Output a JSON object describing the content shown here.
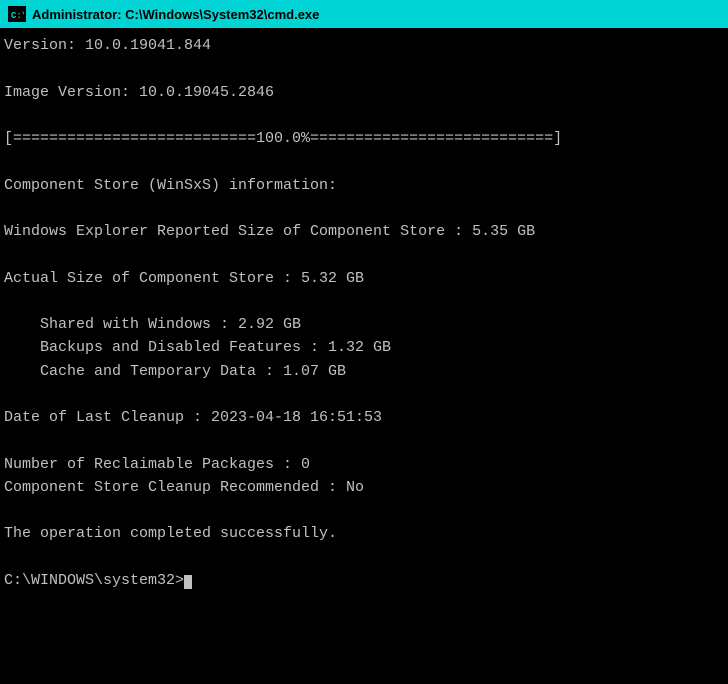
{
  "titleBar": {
    "label": "Administrator: C:\\Windows\\System32\\cmd.exe"
  },
  "console": {
    "lines": [
      {
        "id": "version",
        "text": "Version: 10.0.19041.844"
      },
      {
        "id": "empty1",
        "text": ""
      },
      {
        "id": "image-version",
        "text": "Image Version: 10.0.19045.2846"
      },
      {
        "id": "empty2",
        "text": ""
      },
      {
        "id": "progress",
        "text": "[===========================100.0%===========================]"
      },
      {
        "id": "empty3",
        "text": ""
      },
      {
        "id": "component-store-header",
        "text": "Component Store (WinSxS) information:"
      },
      {
        "id": "empty4",
        "text": ""
      },
      {
        "id": "explorer-size",
        "text": "Windows Explorer Reported Size of Component Store : 5.35 GB"
      },
      {
        "id": "empty5",
        "text": ""
      },
      {
        "id": "actual-size",
        "text": "Actual Size of Component Store : 5.32 GB"
      },
      {
        "id": "empty6",
        "text": ""
      },
      {
        "id": "shared",
        "text": "    Shared with Windows : 2.92 GB"
      },
      {
        "id": "backups",
        "text": "    Backups and Disabled Features : 1.32 GB"
      },
      {
        "id": "cache",
        "text": "    Cache and Temporary Data : 1.07 GB"
      },
      {
        "id": "empty7",
        "text": ""
      },
      {
        "id": "last-cleanup",
        "text": "Date of Last Cleanup : 2023-04-18 16:51:53"
      },
      {
        "id": "empty8",
        "text": ""
      },
      {
        "id": "reclaimable",
        "text": "Number of Reclaimable Packages : 0"
      },
      {
        "id": "cleanup-recommended",
        "text": "Component Store Cleanup Recommended : No"
      },
      {
        "id": "empty9",
        "text": ""
      },
      {
        "id": "operation-complete",
        "text": "The operation completed successfully."
      },
      {
        "id": "empty10",
        "text": ""
      },
      {
        "id": "prompt",
        "text": "C:\\WINDOWS\\system32>"
      }
    ]
  }
}
